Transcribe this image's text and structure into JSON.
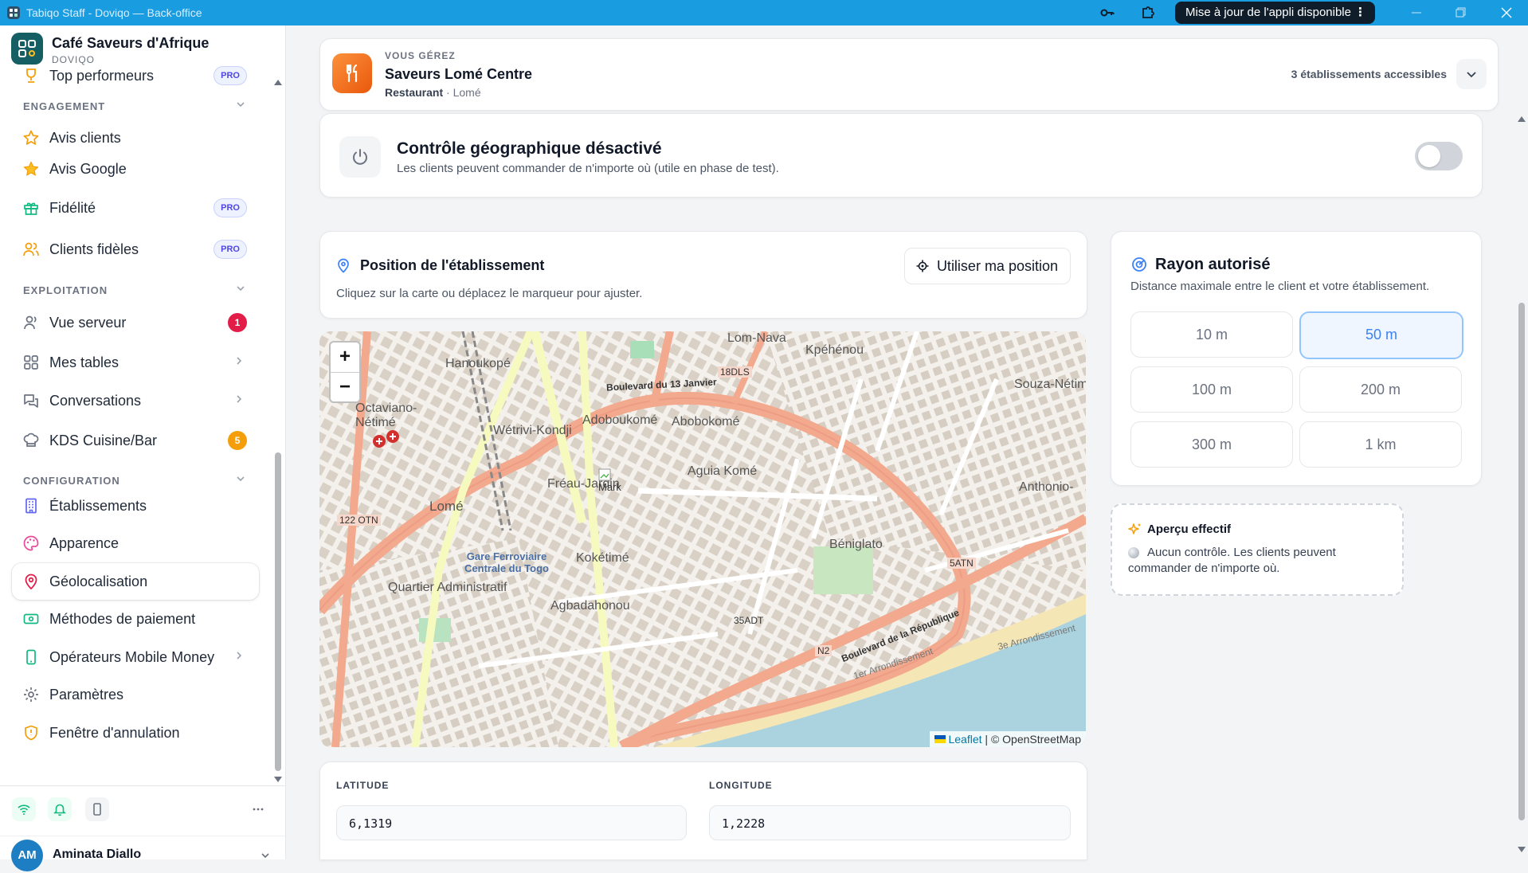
{
  "window": {
    "title": "Tabiqo Staff - Doviqo — Back-office",
    "update_label": "Mise à jour de l'appli disponible"
  },
  "brand": {
    "name": "Café Saveurs d'Afrique",
    "sub": "DOVIQO"
  },
  "sidebar": {
    "top_item": {
      "label": "Top performeurs",
      "badge": "PRO"
    },
    "sections": [
      {
        "label": "ENGAGEMENT"
      },
      {
        "label": "EXPLOITATION"
      },
      {
        "label": "CONFIGURATION"
      }
    ],
    "items": [
      {
        "label": "Avis clients",
        "icon": "star-outline-icon"
      },
      {
        "label": "Avis Google",
        "icon": "star-filled-icon"
      },
      {
        "label": "Fidélité",
        "icon": "gift-icon",
        "badge": "PRO"
      },
      {
        "label": "Clients fidèles",
        "icon": "users-icon",
        "badge": "PRO"
      },
      {
        "label": "Vue serveur",
        "icon": "user-icon",
        "count": "1",
        "count_color": "#e11d48"
      },
      {
        "label": "Mes tables",
        "icon": "grid-icon"
      },
      {
        "label": "Conversations",
        "icon": "chat-icon"
      },
      {
        "label": "KDS Cuisine/Bar",
        "icon": "chef-hat-icon",
        "count": "5",
        "count_color": "#f59e0b"
      },
      {
        "label": "Établissements",
        "icon": "building-icon"
      },
      {
        "label": "Apparence",
        "icon": "palette-icon"
      },
      {
        "label": "Géolocalisation",
        "icon": "map-pin-icon",
        "active": true
      },
      {
        "label": "Méthodes de paiement",
        "icon": "banknote-icon"
      },
      {
        "label": "Opérateurs Mobile Money",
        "icon": "smartphone-icon"
      },
      {
        "label": "Paramètres",
        "icon": "gear-icon"
      },
      {
        "label": "Fenêtre d'annulation",
        "icon": "shield-icon"
      }
    ],
    "user": {
      "initials": "AM",
      "name": "Aminata Diallo"
    }
  },
  "establishment": {
    "kicker": "VOUS GÉREZ",
    "name": "Saveurs Lomé Centre",
    "type": "Restaurant",
    "city": "Lomé",
    "count_label": "3 établissements accessibles"
  },
  "geo_control": {
    "title": "Contrôle géographique désactivé",
    "subtitle": "Les clients peuvent commander de n'importe où (utile en phase de test).",
    "enabled": false
  },
  "position": {
    "title": "Position de l'établissement",
    "subtitle": "Cliquez sur la carte ou déplacez le marqueur pour ajuster.",
    "use_location_label": "Utiliser ma position"
  },
  "map": {
    "zoom_in": "+",
    "zoom_out": "−",
    "attribution_leaflet": "Leaflet",
    "attribution_rest": "| © OpenStreetMap",
    "marker_label": "Mark",
    "labels": [
      "Hanoukopé",
      "Octaviano-Nétimé",
      "Wétrivi-Kondji",
      "Adoboukomé",
      "Abobokomé",
      "Lom-Nava",
      "Kpéhénou",
      "Souza-Nétim",
      "Fréau-Jardin",
      "Aguia Komé",
      "Lomé",
      "Gare Ferroviaire Centrale du Togo",
      "Kokétimé",
      "Béniglato",
      "Anthonio-",
      "Quartier Administratif",
      "Agbadahonou",
      "Boulevard du 13 Janvier",
      "Boulevard de la République",
      "1er Arrondissement",
      "3e Arrondissement",
      "122 OTN",
      "18DLS",
      "35ADT",
      "5ATN",
      "N2"
    ]
  },
  "coords": {
    "lat_label": "LATITUDE",
    "lat_value": "6,1319",
    "lng_label": "LONGITUDE",
    "lng_value": "1,2228"
  },
  "radius": {
    "title": "Rayon autorisé",
    "subtitle": "Distance maximale entre le client et votre établissement.",
    "options": [
      "10 m",
      "50 m",
      "100 m",
      "200 m",
      "300 m",
      "1 km"
    ],
    "selected": "50 m"
  },
  "preview": {
    "title": "Aperçu effectif",
    "text": "Aucun contrôle. Les clients peuvent commander de n'importe où."
  },
  "colors": {
    "titlebar": "#1a9ce1",
    "accent_green": "#10b981",
    "accent_blue": "#3b82f6",
    "brand": "#155e63"
  }
}
